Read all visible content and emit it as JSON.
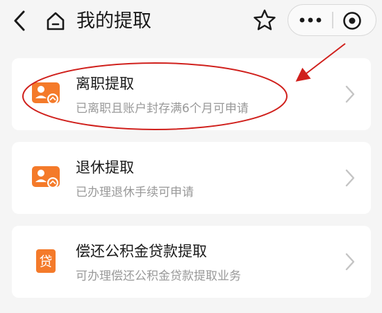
{
  "header": {
    "title": "我的提取",
    "icons": {
      "back": "chevron-left-icon",
      "home": "home-icon",
      "favorite": "star-icon",
      "more": "more-dots-icon",
      "close": "target-close-icon"
    }
  },
  "options": [
    {
      "title": "离职提取",
      "subtitle": "已离职且账户封存满6个月可申请",
      "icon": "resign-card-icon",
      "highlighted": true
    },
    {
      "title": "退休提取",
      "subtitle": "已办理退休手续可申请",
      "icon": "retire-card-icon",
      "highlighted": false
    },
    {
      "title": "偿还公积金贷款提取",
      "subtitle": "可办理偿还公积金贷款提取业务",
      "icon": "loan-icon",
      "icon_text": "贷",
      "highlighted": false
    }
  ],
  "colors": {
    "accent_orange": "#f47a2a",
    "annotation_red": "#d0201c"
  }
}
